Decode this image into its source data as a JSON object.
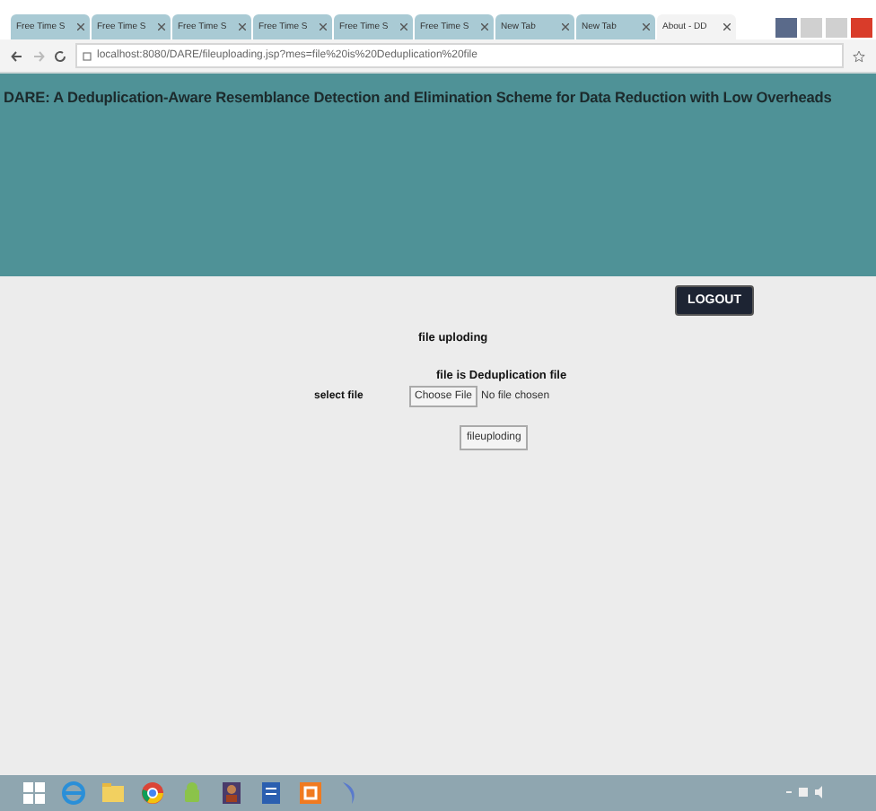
{
  "browser": {
    "tabs": [
      {
        "label": "Free Time S",
        "selected": false
      },
      {
        "label": "Free Time S",
        "selected": false
      },
      {
        "label": "Free Time S",
        "selected": false
      },
      {
        "label": "Free Time S",
        "selected": false
      },
      {
        "label": "Free Time S",
        "selected": false
      },
      {
        "label": "Free Time S",
        "selected": false
      },
      {
        "label": "New Tab",
        "selected": false
      },
      {
        "label": "New Tab",
        "selected": false
      },
      {
        "label": "About - DD",
        "selected": true
      }
    ],
    "address": "localhost:8080/DARE/fileuploading.jsp?mes=file%20is%20Deduplication%20file"
  },
  "header": {
    "title": "DARE: A Deduplication-Aware Resemblance Detection and Elimination Scheme for Data Reduction with Low Overheads"
  },
  "logout_button": "LOGOUT",
  "form": {
    "heading": "file uploding",
    "message": "file is Deduplication file",
    "label": "select file",
    "choose_button": "Choose File",
    "file_status": "No file chosen",
    "submit_button": "fileuploding"
  }
}
